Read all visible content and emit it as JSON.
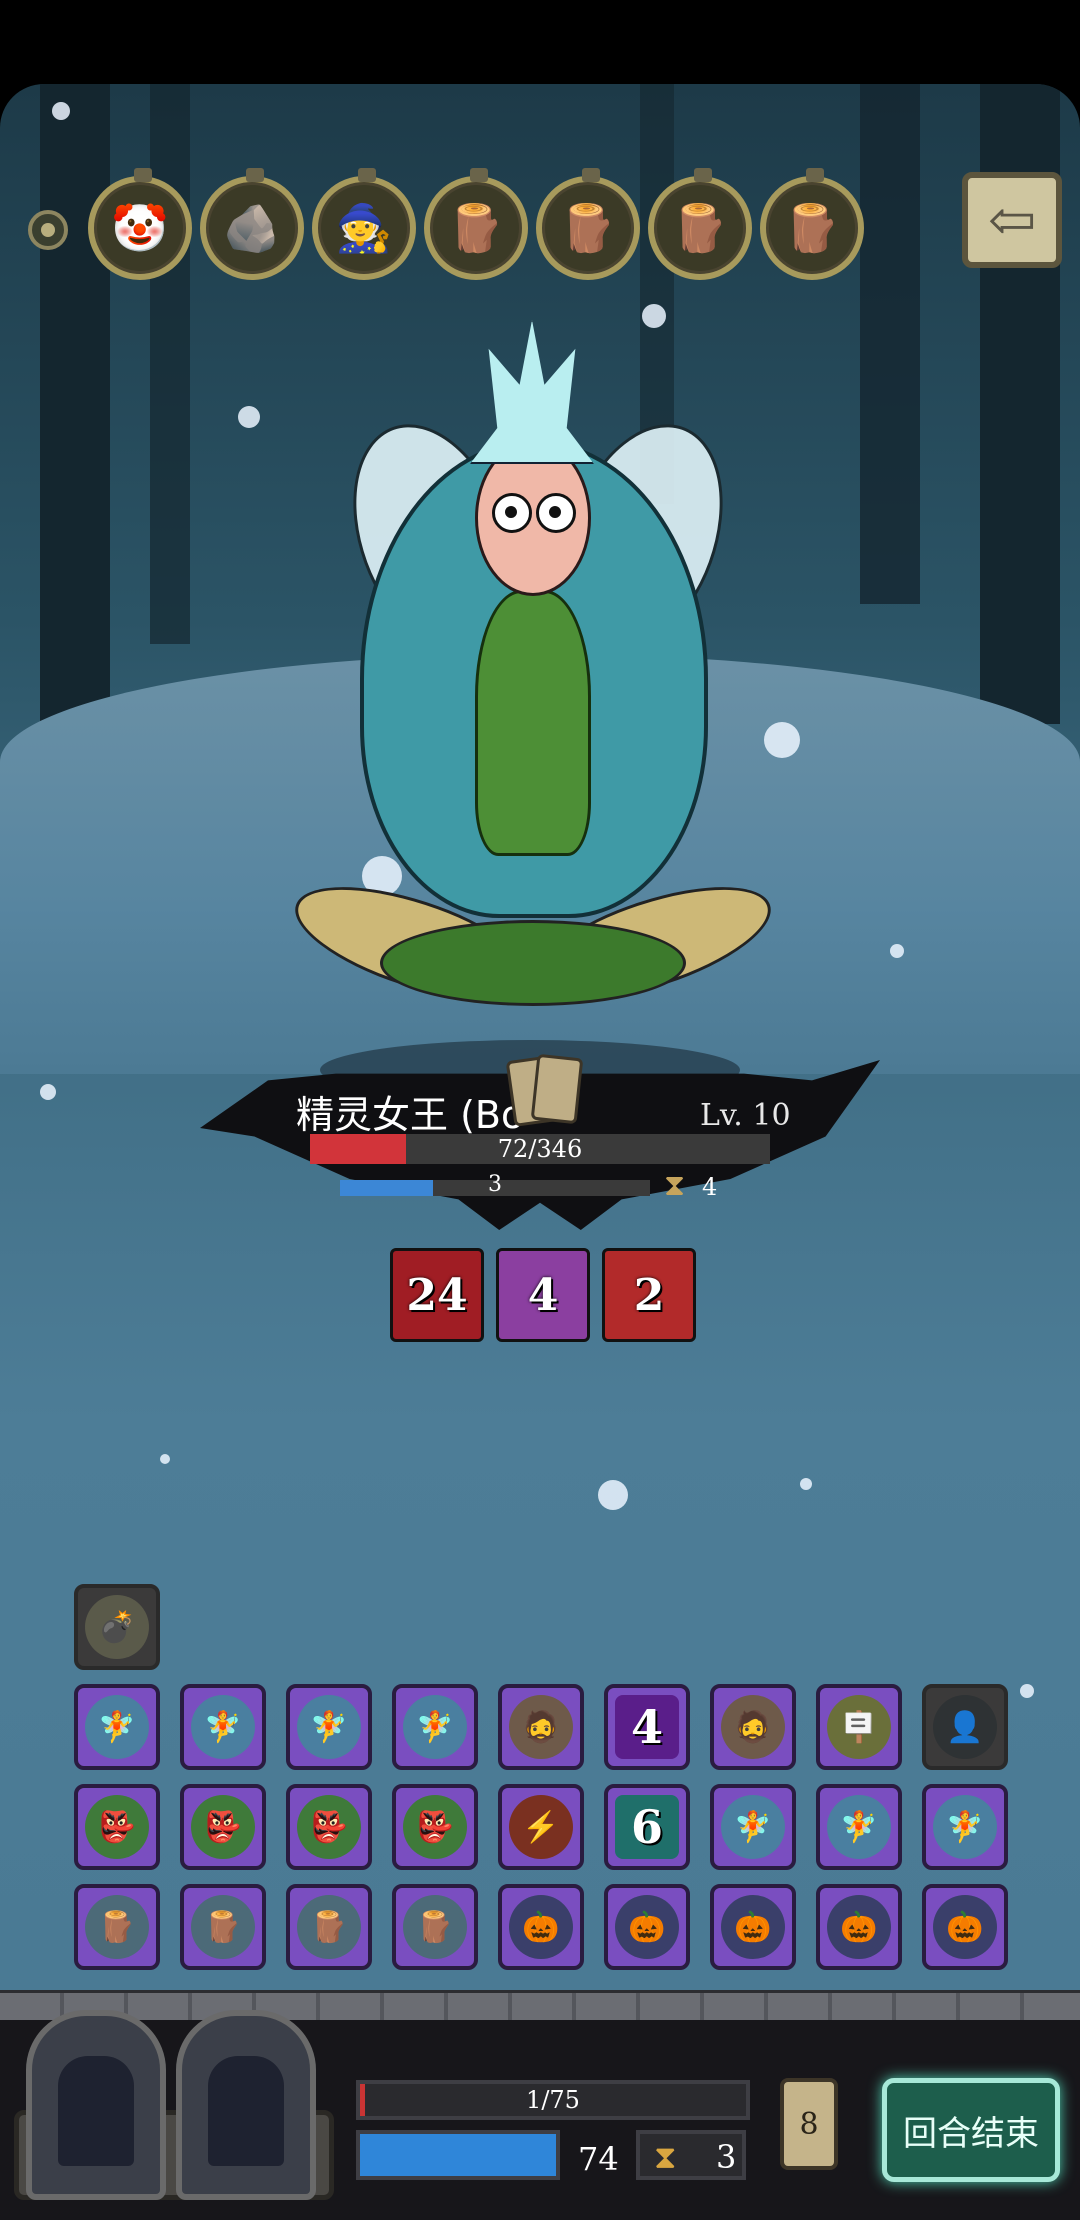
{
  "turn_order": [
    {
      "icon": "scarecrow-hero-icon",
      "glyph": "🤡"
    },
    {
      "icon": "rock-enemy-icon",
      "glyph": "🪨"
    },
    {
      "icon": "wizard-enemy-icon",
      "glyph": "🧙"
    },
    {
      "icon": "log-trap-icon",
      "glyph": "🪵"
    },
    {
      "icon": "log-trap-icon",
      "glyph": "🪵"
    },
    {
      "icon": "log-trap-icon",
      "glyph": "🪵"
    },
    {
      "icon": "log-trap-icon",
      "glyph": "🪵"
    }
  ],
  "back_button_glyph": "⇦",
  "boss": {
    "name": "精灵女王 (Bo",
    "level": "Lv. 10",
    "hp_text": "72/346",
    "hp_fraction": 0.208,
    "mp_text": "3",
    "mp_fraction": 0.3,
    "timer": "4"
  },
  "boss_statuses": [
    {
      "value": "24",
      "color": "#a01d24"
    },
    {
      "value": "4",
      "color": "#8b3fa0"
    },
    {
      "value": "2",
      "color": "#b22a2a"
    }
  ],
  "hand": {
    "special_tile": {
      "icon": "bomb-icon",
      "glyph": "💣"
    },
    "rows": [
      [
        {
          "kind": "icon",
          "icon": "fairy-icon",
          "glyph": "🧚"
        },
        {
          "kind": "icon",
          "icon": "fairy-icon",
          "glyph": "🧚"
        },
        {
          "kind": "icon",
          "icon": "fairy-icon",
          "glyph": "🧚"
        },
        {
          "kind": "icon",
          "icon": "fairy-icon",
          "glyph": "🧚"
        },
        {
          "kind": "icon",
          "icon": "dwarf-icon",
          "glyph": "🧔"
        },
        {
          "kind": "counter",
          "icon": "eye-icon",
          "value": "4"
        },
        {
          "kind": "icon",
          "icon": "dwarf-icon",
          "glyph": "🧔"
        },
        {
          "kind": "icon",
          "icon": "sign-icon",
          "glyph": "🪧"
        },
        {
          "kind": "dark",
          "icon": "hooded-figure-icon",
          "glyph": "👤"
        }
      ],
      [
        {
          "kind": "icon",
          "icon": "goblin-icon",
          "glyph": "👺"
        },
        {
          "kind": "icon",
          "icon": "goblin-icon",
          "glyph": "👺"
        },
        {
          "kind": "icon",
          "icon": "goblin-icon",
          "glyph": "👺"
        },
        {
          "kind": "icon",
          "icon": "goblin-icon",
          "glyph": "👺"
        },
        {
          "kind": "icon",
          "icon": "lightning-icon",
          "glyph": "⚡"
        },
        {
          "kind": "counter",
          "icon": "spiral-icon",
          "value": "6"
        },
        {
          "kind": "icon",
          "icon": "fairy-icon",
          "glyph": "🧚"
        },
        {
          "kind": "icon",
          "icon": "fairy-icon",
          "glyph": "🧚"
        },
        {
          "kind": "icon",
          "icon": "fairy-icon",
          "glyph": "🧚"
        }
      ],
      [
        {
          "kind": "icon",
          "icon": "log-trap-icon",
          "glyph": "🪵"
        },
        {
          "kind": "icon",
          "icon": "log-trap-icon",
          "glyph": "🪵"
        },
        {
          "kind": "icon",
          "icon": "log-trap-icon",
          "glyph": "🪵"
        },
        {
          "kind": "icon",
          "icon": "log-trap-icon",
          "glyph": "🪵"
        },
        {
          "kind": "icon",
          "icon": "scarecrow-icon",
          "glyph": "🎃"
        },
        {
          "kind": "icon",
          "icon": "scarecrow-icon",
          "glyph": "🎃"
        },
        {
          "kind": "icon",
          "icon": "scarecrow-icon",
          "glyph": "🎃"
        },
        {
          "kind": "icon",
          "icon": "scarecrow-icon",
          "glyph": "🎃"
        },
        {
          "kind": "icon",
          "icon": "scarecrow-icon",
          "glyph": "🎃"
        }
      ]
    ]
  },
  "player": {
    "hp_text": "1/75",
    "hp_fraction": 0.013,
    "mp_value": "74",
    "mp_fraction": 1.0,
    "timer": "3",
    "card_count": "8"
  },
  "end_turn_label": "回合结束"
}
